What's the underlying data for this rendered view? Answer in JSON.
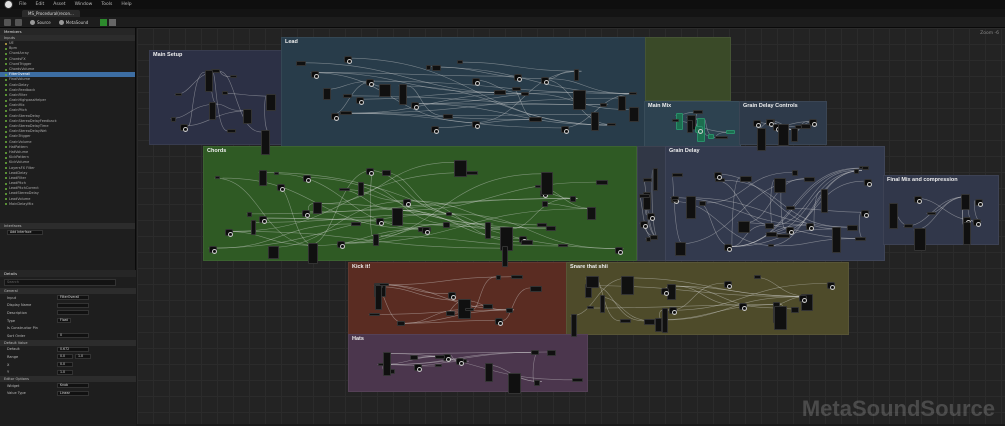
{
  "menu": {
    "items": [
      "File",
      "Edit",
      "Asset",
      "Window",
      "Tools",
      "Help"
    ]
  },
  "tab": {
    "label": "MS_Procedural(recon..."
  },
  "toolbar": {
    "source_label": "Source",
    "metasound_label": "MetaSound"
  },
  "left_panel": {
    "header": "Members",
    "inputs_section": "Inputs",
    "members": [
      "UE",
      "Bpm",
      "ChordArray",
      "ChordsFX",
      "ChordTrigger",
      "ChordsVolume",
      "FilterOverall",
      "FinalVolume",
      "GrainDelay",
      "GrainFeedback",
      "GrainFilter",
      "GrainHighpassHelper",
      "GrainMix",
      "GrainPitch",
      "GrainStereoDelay",
      "GrainStereoDelayFeedback",
      "GrainStereoDelayTime",
      "GrainStereoDelayWet",
      "GrainTrigger",
      "GrainVolume",
      "HatPattern",
      "HatVolume",
      "KickPattern",
      "KickVolume",
      "LayersFX Filter",
      "LeadDelay",
      "LeadFilter",
      "LeadPitch",
      "LeadPitchCorrect",
      "LeadStereoDelay",
      "LeadVolume",
      "MainDelayMix"
    ],
    "selected_member": "FilterOverall",
    "interfaces_section": "Interfaces",
    "interface_value": "Add Interface"
  },
  "details": {
    "header": "Details",
    "search_placeholder": "Search",
    "general_section": "General",
    "input_label": "Input",
    "input_value": "FilterOverall",
    "display_name_label": "Display Name",
    "description_label": "Description",
    "type_label": "Type",
    "type_value": "Float",
    "is_constructor_label": "Is Constructor Pin",
    "sort_order_label": "Sort Order",
    "sort_order_value": "0",
    "default_section": "Default Value",
    "default_label": "Default",
    "default_value": "0.672",
    "range_label": "Range",
    "range_min": "0.0",
    "range_max": "1.0",
    "x_label": "X",
    "x_value": "0.0",
    "y_label": "Y",
    "y_value": "1.0",
    "editor_section": "Editor Options",
    "widget_label": "Widget",
    "widget_value": "Knob",
    "value_type_label": "Value Type",
    "value_type_value": "Linear"
  },
  "graph": {
    "zoom_label": "Zoom -6",
    "watermark": "MetaSoundSource",
    "comments": {
      "lead": "Lead",
      "main_setup": "Main Setup",
      "chords": "Chords",
      "main_mix": "Main Mix",
      "grain_delay_controls": "Grain Delay Controls",
      "grain_delay": "Grain Delay",
      "final_mix": "Final Mix and compression",
      "kick": "Kick it!",
      "snare": "Snare that shii",
      "hats": "Hats"
    },
    "colors": {
      "lead": "#283c4a",
      "main_setup": "#2c3045",
      "chords": "#2f5a24",
      "main_mix": "#2d4250",
      "grain_delay_controls": "#2e3a4a",
      "grain_delay": "#333a4e",
      "final_mix": "#31374a",
      "kick": "#5a2c22",
      "snare": "#4e4b2a",
      "hats": "#4b364d",
      "selection": "#3d6ea3"
    }
  }
}
